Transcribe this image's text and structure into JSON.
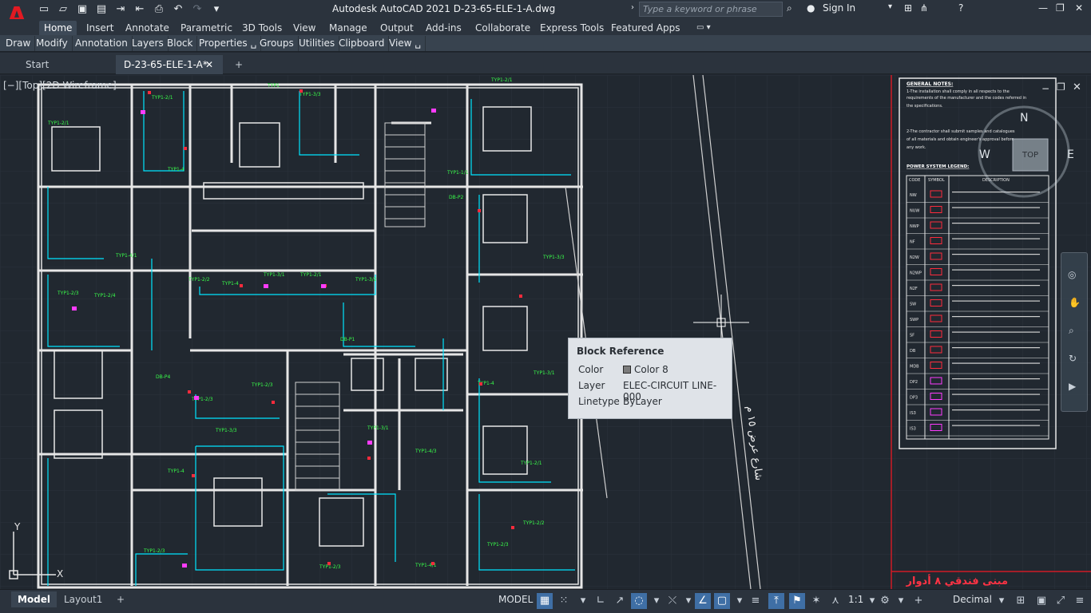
{
  "app": {
    "logo_letter": "A",
    "title": "Autodesk AutoCAD 2021    D-23-65-ELE-1-A.dwg",
    "search_placeholder": "Type a keyword or phrase",
    "sign_in": "Sign In"
  },
  "ribbon_tabs": [
    {
      "label": "Home",
      "active": true
    },
    {
      "label": "Insert"
    },
    {
      "label": "Annotate"
    },
    {
      "label": "Parametric"
    },
    {
      "label": "3D Tools"
    },
    {
      "label": "View"
    },
    {
      "label": "Manage"
    },
    {
      "label": "Output"
    },
    {
      "label": "Add-ins"
    },
    {
      "label": "Collaborate"
    },
    {
      "label": "Express Tools"
    },
    {
      "label": "Featured Apps"
    }
  ],
  "panels": [
    "Draw",
    "Modify",
    "Annotation",
    "Layers",
    "Block",
    "Properties ␣",
    "Groups",
    "Utilities",
    "Clipboard",
    "View ␣"
  ],
  "file_tabs": [
    {
      "label": "Start"
    },
    {
      "label": "D-23-65-ELE-1-A*",
      "active": true
    }
  ],
  "viewport": {
    "label": "[−][Top][2D Wireframe]",
    "compass": {
      "n": "N",
      "e": "E",
      "w": "W",
      "cube": "TOP"
    },
    "axis_y": "Y",
    "axis_x": "X",
    "title_block_text": "مبنى فندقي ٨ أدوار",
    "side_text": "شارع عرض ١٥ م",
    "notes_heading": "GENERAL NOTES:",
    "legend_heading": "POWER SYSTEM LEGEND:",
    "legend_columns": [
      "CODE",
      "SYMBOL",
      "DESCRIPTION"
    ],
    "legend_codes": [
      "NW",
      "NUW",
      "NWP",
      "NF",
      "N2W",
      "N2WP",
      "N2F",
      "SW",
      "SWP",
      "SF",
      "DB",
      "MDB",
      "DP2",
      "DP3",
      "IS3",
      "IS3"
    ]
  },
  "tooltip": {
    "title": "Block Reference",
    "rows": [
      {
        "key": "Color",
        "value": "Color 8"
      },
      {
        "key": "Layer",
        "value": "ELEC-CIRCUIT LINE-000"
      },
      {
        "key": "Linetype",
        "value": "ByLayer"
      }
    ]
  },
  "bottom_tabs": [
    {
      "label": "Model",
      "active": true
    },
    {
      "label": "Layout1"
    }
  ],
  "status": {
    "model": "MODEL",
    "scale": "1:1",
    "units": "Decimal"
  },
  "colors": {
    "drawing_bg": "#212830",
    "wall_lines": "#e8e8e8",
    "circuit_lines": "#00e5ff",
    "labels": "#39ff4a",
    "symbols": "#ff2b3c"
  }
}
